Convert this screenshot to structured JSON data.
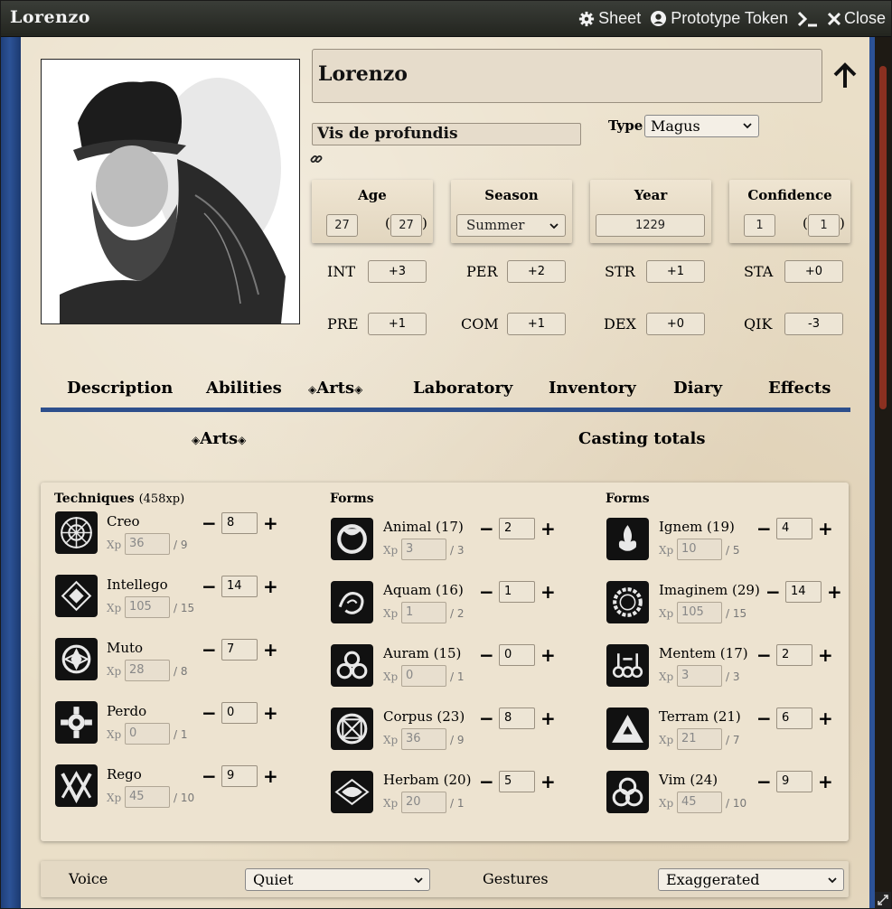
{
  "window": {
    "title": "Lorenzo",
    "controls": {
      "sheet": "Sheet",
      "prototype_token": "Prototype Token",
      "close": "Close"
    }
  },
  "character": {
    "name": "Lorenzo",
    "subtitle": "Vis de profundis",
    "type_label": "Type",
    "type_value": "Magus"
  },
  "stats": {
    "age": {
      "label": "Age",
      "value": "27",
      "apparent": "27"
    },
    "season": {
      "label": "Season",
      "value": "Summer"
    },
    "year": {
      "label": "Year",
      "value": "1229"
    },
    "confidence": {
      "label": "Confidence",
      "value": "1",
      "points": "1"
    }
  },
  "characteristics": [
    {
      "label": "INT",
      "value": "+3"
    },
    {
      "label": "PER",
      "value": "+2"
    },
    {
      "label": "STR",
      "value": "+1"
    },
    {
      "label": "STA",
      "value": "+0"
    },
    {
      "label": "PRE",
      "value": "+1"
    },
    {
      "label": "COM",
      "value": "+1"
    },
    {
      "label": "DEX",
      "value": "+0"
    },
    {
      "label": "QIK",
      "value": "-3"
    }
  ],
  "tabs": [
    "Description",
    "Abilities",
    "Arts",
    "Laboratory",
    "Inventory",
    "Diary",
    "Effects"
  ],
  "active_tab": "Arts",
  "subtabs": {
    "arts": "Arts",
    "casting": "Casting totals"
  },
  "arts": {
    "techniques_label": "Techniques",
    "techniques_xp": "(458xp)",
    "forms_label": "Forms",
    "xp_label": "Xp",
    "techniques": [
      {
        "name": "Creo",
        "score": "8",
        "xp": "36",
        "next": "/ 9",
        "icon": "creo-icon"
      },
      {
        "name": "Intellego",
        "score": "14",
        "xp": "105",
        "next": "/ 15",
        "icon": "intellego-icon"
      },
      {
        "name": "Muto",
        "score": "7",
        "xp": "28",
        "next": "/ 8",
        "icon": "muto-icon"
      },
      {
        "name": "Perdo",
        "score": "0",
        "xp": "0",
        "next": "/ 1",
        "icon": "perdo-icon"
      },
      {
        "name": "Rego",
        "score": "9",
        "xp": "45",
        "next": "/ 10",
        "icon": "rego-icon"
      }
    ],
    "forms1": [
      {
        "name": "Animal (17)",
        "score": "2",
        "xp": "3",
        "next": "/ 3",
        "icon": "animal-icon"
      },
      {
        "name": "Aquam (16)",
        "score": "1",
        "xp": "1",
        "next": "/ 2",
        "icon": "aquam-icon"
      },
      {
        "name": "Auram (15)",
        "score": "0",
        "xp": "0",
        "next": "/ 1",
        "icon": "auram-icon"
      },
      {
        "name": "Corpus (23)",
        "score": "8",
        "xp": "36",
        "next": "/ 9",
        "icon": "corpus-icon"
      },
      {
        "name": "Herbam (20)",
        "score": "5",
        "xp": "20",
        "next": "/ 1",
        "icon": "herbam-icon"
      }
    ],
    "forms2": [
      {
        "name": "Ignem (19)",
        "score": "4",
        "xp": "10",
        "next": "/ 5",
        "icon": "ignem-icon"
      },
      {
        "name": "Imaginem (29)",
        "score": "14",
        "xp": "105",
        "next": "/ 15",
        "icon": "imaginem-icon"
      },
      {
        "name": "Mentem (17)",
        "score": "2",
        "xp": "3",
        "next": "/ 3",
        "icon": "mentem-icon"
      },
      {
        "name": "Terram (21)",
        "score": "6",
        "xp": "21",
        "next": "/ 7",
        "icon": "terram-icon"
      },
      {
        "name": "Vim (24)",
        "score": "9",
        "xp": "45",
        "next": "/ 10",
        "icon": "vim-icon"
      }
    ]
  },
  "casting": {
    "voice_label": "Voice",
    "voice_value": "Quiet",
    "gestures_label": "Gestures",
    "gestures_value": "Exaggerated"
  },
  "colors": {
    "accent_blue": "#2d4f8c",
    "scroll_thumb": "#8a3020",
    "parchment": "#eadfc8"
  }
}
